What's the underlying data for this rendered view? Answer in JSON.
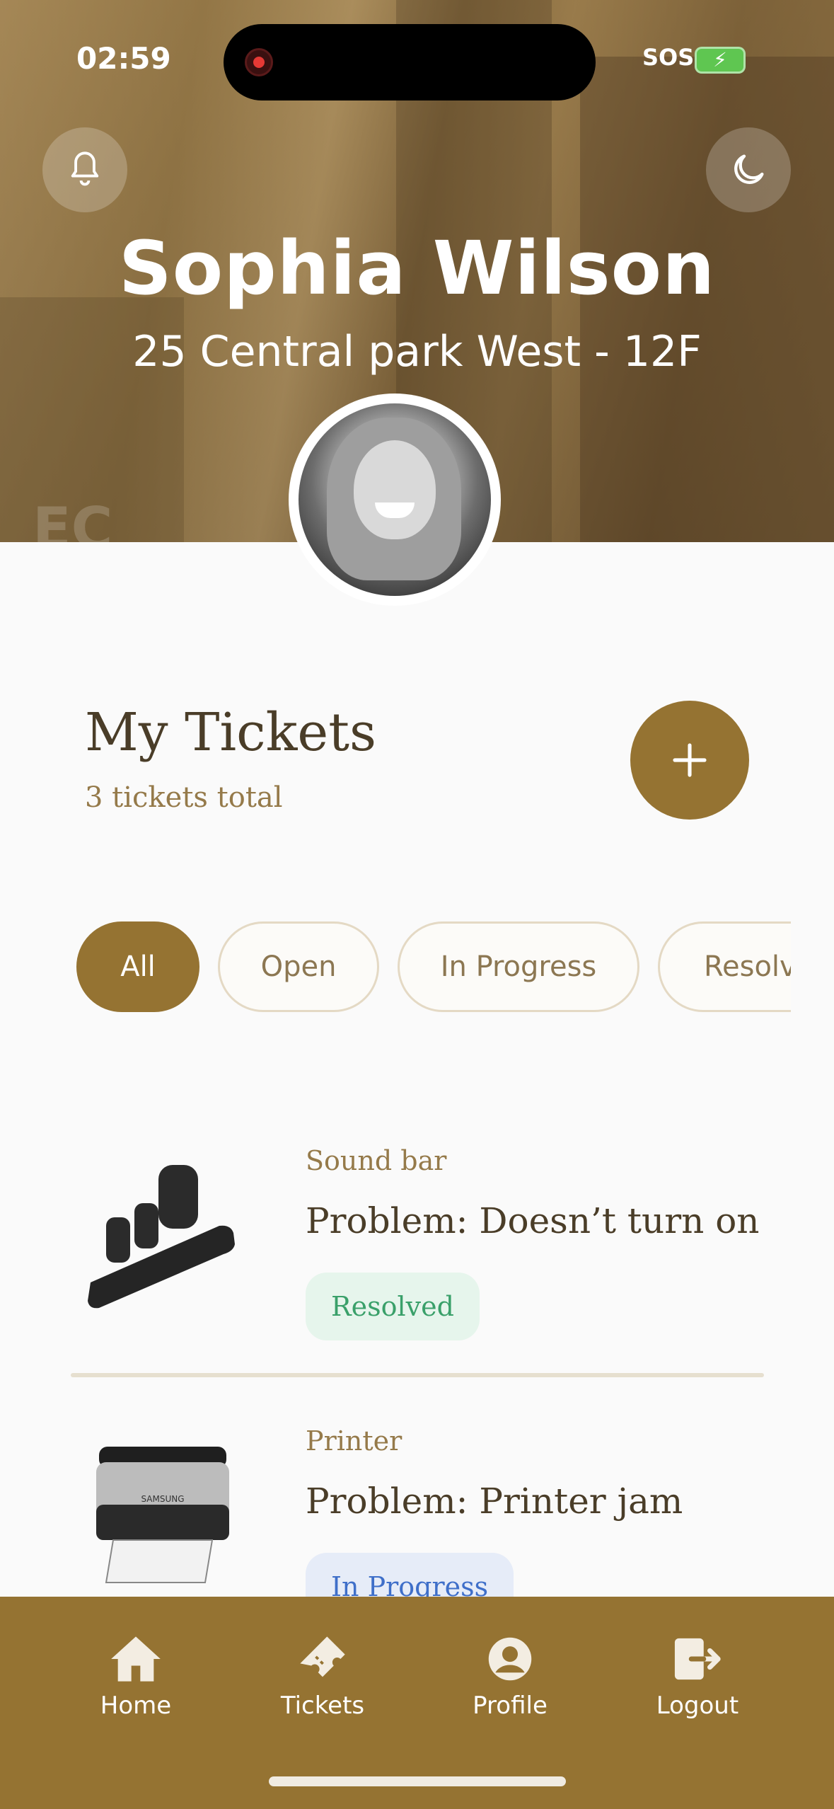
{
  "status_bar": {
    "time": "02:59",
    "sos": "SOS"
  },
  "header": {
    "name": "Sophia Wilson",
    "address": "25 Central park West - 12F",
    "watermark": "EC"
  },
  "tickets_section": {
    "title": "My Tickets",
    "subtitle": "3 tickets total"
  },
  "filters": [
    {
      "label": "All",
      "active": true
    },
    {
      "label": "Open",
      "active": false
    },
    {
      "label": "In Progress",
      "active": false
    },
    {
      "label": "Resolv",
      "active": false
    }
  ],
  "tickets": [
    {
      "category": "Sound bar",
      "title": "Problem: Doesn’t turn on",
      "status": "Resolved"
    },
    {
      "category": "Printer",
      "title": "Problem: Printer jam",
      "status": "In Progress"
    }
  ],
  "printer_brand": "SAMSUNG",
  "tabbar": [
    {
      "label": "Home",
      "icon": "home-icon"
    },
    {
      "label": "Tickets",
      "icon": "ticket-icon"
    },
    {
      "label": "Profile",
      "icon": "profile-icon"
    },
    {
      "label": "Logout",
      "icon": "logout-icon"
    }
  ],
  "colors": {
    "accent": "#957332",
    "resolved": "#3aa06a",
    "in_progress": "#3f6fc9"
  }
}
